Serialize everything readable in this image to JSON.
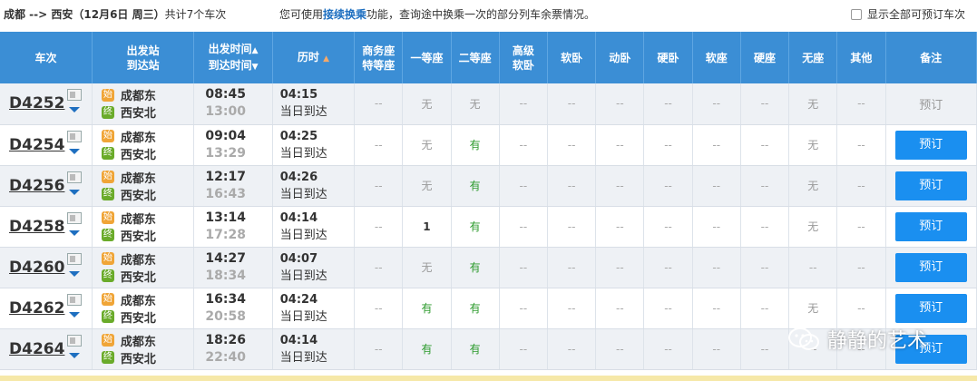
{
  "header": {
    "route": "成都 --> 西安（12月6日  周三）",
    "count": "共计7个车次",
    "hint_prefix": "您可使用",
    "hint_link": "接续换乘",
    "hint_suffix": "功能，查询途中换乘一次的部分列车余票情况。",
    "show_all": "显示全部可预订车次"
  },
  "columns": {
    "train": "车次",
    "station_from": "出发站",
    "station_to": "到达站",
    "depart_time": "出发时间",
    "arrive_time": "到达时间",
    "duration": "历时",
    "business_1": "商务座",
    "business_2": "特等座",
    "first": "一等座",
    "second": "二等座",
    "adv_1": "高级",
    "adv_2": "软卧",
    "soft_sleeper": "软卧",
    "moving_sleeper": "动卧",
    "hard_sleeper": "硬卧",
    "soft_seat": "软座",
    "hard_seat": "硬座",
    "no_seat": "无座",
    "other": "其他",
    "remarks": "备注"
  },
  "rows": [
    {
      "train": "D4252",
      "start_badge": "始",
      "end_badge": "终",
      "from": "成都东",
      "to": "西安北",
      "depart": "08:45",
      "arrive": "13:00",
      "duration": "04:15",
      "arrival_day": "当日到达",
      "seats": [
        "--",
        "无",
        "无",
        "--",
        "--",
        "--",
        "--",
        "--",
        "--",
        "无",
        "--"
      ],
      "remark": "预订",
      "bookable": false
    },
    {
      "train": "D4254",
      "start_badge": "始",
      "end_badge": "终",
      "from": "成都东",
      "to": "西安北",
      "depart": "09:04",
      "arrive": "13:29",
      "duration": "04:25",
      "arrival_day": "当日到达",
      "seats": [
        "--",
        "无",
        "有",
        "--",
        "--",
        "--",
        "--",
        "--",
        "--",
        "无",
        "--"
      ],
      "remark": "预订",
      "bookable": true
    },
    {
      "train": "D4256",
      "start_badge": "始",
      "end_badge": "终",
      "from": "成都东",
      "to": "西安北",
      "depart": "12:17",
      "arrive": "16:43",
      "duration": "04:26",
      "arrival_day": "当日到达",
      "seats": [
        "--",
        "无",
        "有",
        "--",
        "--",
        "--",
        "--",
        "--",
        "--",
        "无",
        "--"
      ],
      "remark": "预订",
      "bookable": true
    },
    {
      "train": "D4258",
      "start_badge": "始",
      "end_badge": "终",
      "from": "成都东",
      "to": "西安北",
      "depart": "13:14",
      "arrive": "17:28",
      "duration": "04:14",
      "arrival_day": "当日到达",
      "seats": [
        "--",
        "1",
        "有",
        "--",
        "--",
        "--",
        "--",
        "--",
        "--",
        "无",
        "--"
      ],
      "remark": "预订",
      "bookable": true
    },
    {
      "train": "D4260",
      "start_badge": "始",
      "end_badge": "终",
      "from": "成都东",
      "to": "西安北",
      "depart": "14:27",
      "arrive": "18:34",
      "duration": "04:07",
      "arrival_day": "当日到达",
      "seats": [
        "--",
        "无",
        "有",
        "--",
        "--",
        "--",
        "--",
        "--",
        "--",
        "--",
        "--"
      ],
      "remark": "预订",
      "bookable": true
    },
    {
      "train": "D4262",
      "start_badge": "始",
      "end_badge": "终",
      "from": "成都东",
      "to": "西安北",
      "depart": "16:34",
      "arrive": "20:58",
      "duration": "04:24",
      "arrival_day": "当日到达",
      "seats": [
        "--",
        "有",
        "有",
        "--",
        "--",
        "--",
        "--",
        "--",
        "--",
        "无",
        "--"
      ],
      "remark": "预订",
      "bookable": true
    },
    {
      "train": "D4264",
      "start_badge": "始",
      "end_badge": "终",
      "from": "成都东",
      "to": "西安北",
      "depart": "18:26",
      "arrive": "22:40",
      "duration": "04:14",
      "arrival_day": "当日到达",
      "seats": [
        "--",
        "有",
        "有",
        "--",
        "--",
        "--",
        "--",
        "--",
        "--",
        "--",
        "--"
      ],
      "remark": "预订",
      "bookable": true
    }
  ],
  "watermark": {
    "text": "静静的艺术",
    "icon": "wechat-logo-icon"
  },
  "colors": {
    "header_bg": "#3b8ed5",
    "book_button": "#1a8ff0",
    "available": "#2b9a2b",
    "start_badge": "#f0a537",
    "end_badge": "#6aab2a"
  }
}
